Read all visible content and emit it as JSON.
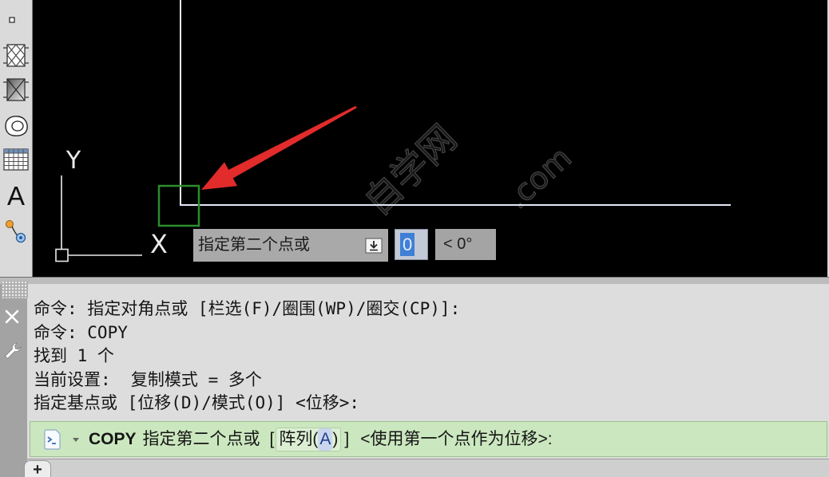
{
  "toolbar": {
    "items": [
      {
        "icon": "point-icon"
      },
      {
        "icon": "hatch-icon"
      },
      {
        "icon": "gradient-icon"
      },
      {
        "icon": "region-icon"
      },
      {
        "icon": "table-icon"
      },
      {
        "icon": "multiline-text-icon",
        "glyph": "A"
      },
      {
        "icon": "add-selected-icon"
      }
    ]
  },
  "drawing": {
    "ucs": {
      "x_label": "X",
      "y_label": "Y"
    },
    "colors": {
      "background": "#000000",
      "geometry": "#e3e9f7",
      "pickbox": "#2d8c2d",
      "annotation_arrow": "#e22b2b"
    }
  },
  "watermark": {
    "text": "自学网",
    "suffix": ".com"
  },
  "dynamic_input": {
    "prompt": "指定第二个点或",
    "prompt_icon": "dropdown-arrow-icon",
    "distance": "0",
    "angle": "< 0°"
  },
  "command_line": {
    "rail_icons": [
      "close-icon",
      "wrench-icon"
    ],
    "history": [
      "命令: 指定对角点或 [栏选(F)/圈围(WP)/圈交(CP)]:",
      "命令: COPY",
      "找到 1 个",
      "当前设置:  复制模式 = 多个",
      "指定基点或 [位移(D)/模式(O)] <位移>:"
    ],
    "input": {
      "recent_icon": "recent-commands-icon",
      "command": "COPY",
      "prompt": "指定第二个点或",
      "bracket_open": "[",
      "option": {
        "label": "阵列(",
        "key": "A",
        "close": ")"
      },
      "bracket_close": "]",
      "default": "<使用第一个点作为位移>:"
    },
    "colors": {
      "panel": "#dddddd",
      "input_background": "#cbe7bf",
      "history_text": "#151515"
    }
  },
  "layout_tabs": {
    "add_label": "+"
  }
}
